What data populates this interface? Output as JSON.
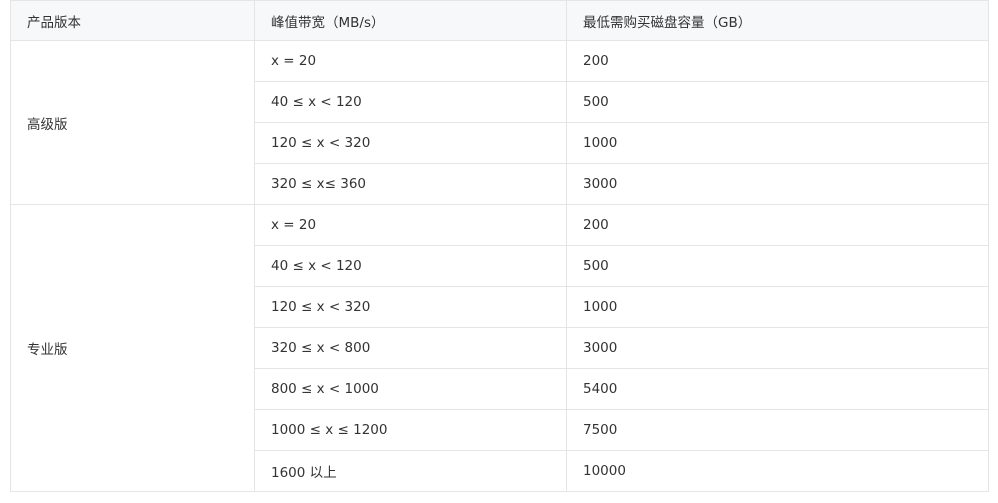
{
  "headers": [
    "产品版本",
    "峰值带宽（MB/s）",
    "最低需购买磁盘容量（GB）"
  ],
  "groups": [
    {
      "edition": "高级版",
      "rows": [
        {
          "bandwidth": "x = 20",
          "capacity": "200"
        },
        {
          "bandwidth": "40 ≤ x < 120",
          "capacity": "500"
        },
        {
          "bandwidth": "120 ≤ x < 320",
          "capacity": "1000"
        },
        {
          "bandwidth": "320 ≤ x≤ 360",
          "capacity": "3000"
        }
      ]
    },
    {
      "edition": "专业版",
      "rows": [
        {
          "bandwidth": "x = 20",
          "capacity": "200"
        },
        {
          "bandwidth": "40 ≤ x < 120",
          "capacity": "500"
        },
        {
          "bandwidth": "120 ≤ x < 320",
          "capacity": "1000"
        },
        {
          "bandwidth": "320 ≤ x < 800",
          "capacity": "3000"
        },
        {
          "bandwidth": "800 ≤ x < 1000",
          "capacity": "5400"
        },
        {
          "bandwidth": "1000 ≤ x ≤ 1200",
          "capacity": "7500"
        },
        {
          "bandwidth": "1600 以上",
          "capacity": "10000"
        }
      ]
    }
  ]
}
